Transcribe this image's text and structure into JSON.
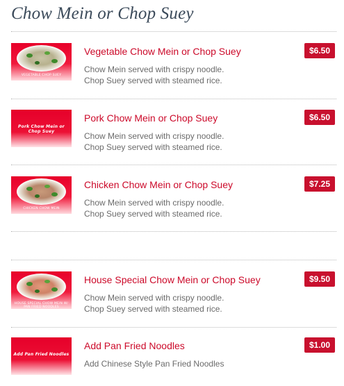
{
  "section": {
    "title": "Chow Mein or Chop Suey"
  },
  "items": [
    {
      "name": "Vegetable Chow Mein or Chop Suey",
      "price": "$6.50",
      "desc_line1": "Chow Mein served with crispy noodle.",
      "desc_line2": "Chop Suey served with steamed rice.",
      "image_caption": "VEGETABLE CHOP SUEY"
    },
    {
      "name": "Pork Chow Mein or Chop Suey",
      "price": "$6.50",
      "desc_line1": "Chow Mein served with crispy noodle.",
      "desc_line2": "Chop Suey served with steamed rice.",
      "image_caption": "Pork Chow Mein or Chop Suey"
    },
    {
      "name": "Chicken Chow Mein or Chop Suey",
      "price": "$7.25",
      "desc_line1": "Chow Mein served with crispy noodle.",
      "desc_line2": "Chop Suey served with steamed rice.",
      "image_caption": "CHICKEN CHOW MEIN"
    },
    {
      "name": "House Special Chow Mein or Chop Suey",
      "price": "$9.50",
      "desc_line1": "Chow Mein served with crispy noodle.",
      "desc_line2": "Chop Suey served with steamed rice.",
      "image_caption": "HOUSE SPECIAL CHOW MEIN W/ PAN FRIED NOODLES"
    },
    {
      "name": "Add Pan Fried Noodles",
      "price": "$1.00",
      "desc_line1": "Add Chinese Style Pan Fried Noodles",
      "image_caption": "Add Pan Fried Noodles"
    }
  ],
  "colors": {
    "title": "#3b4a5a",
    "item_name": "#cc0a2a",
    "price_badge": "#c8102e",
    "description": "#6b6b6b",
    "thumbnail_red": "#e8002a"
  }
}
